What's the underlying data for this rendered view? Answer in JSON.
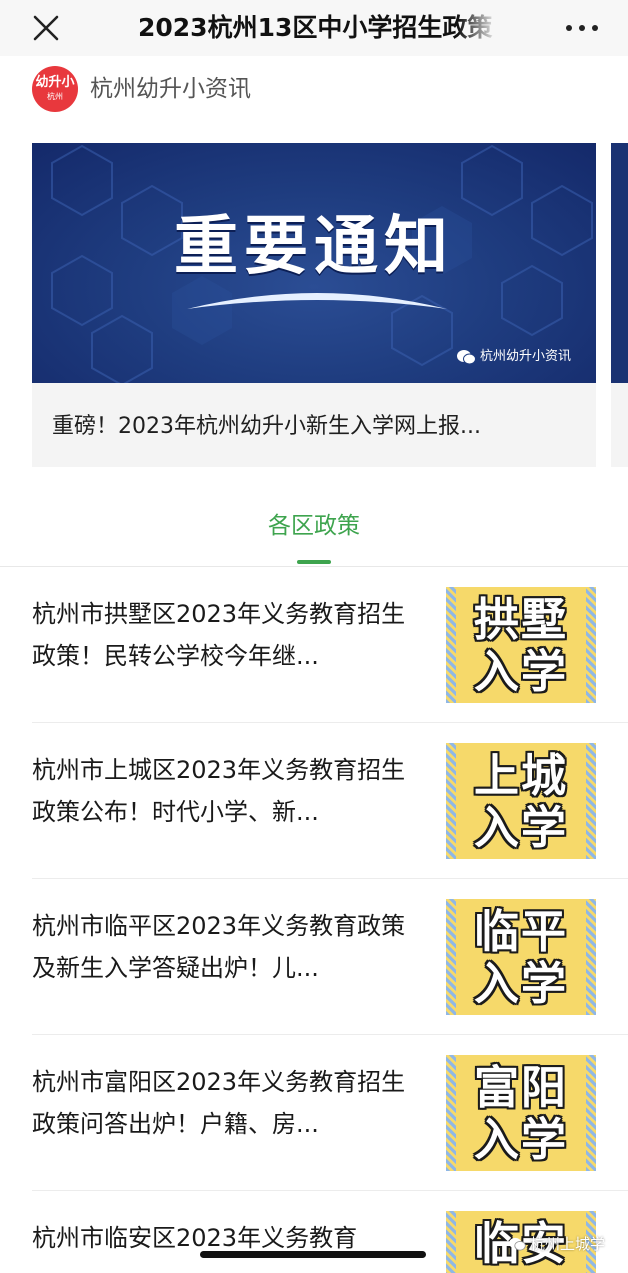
{
  "navbar": {
    "title": "2023杭州13区中小学招生政策",
    "close_icon": "close-icon",
    "more_icon": "more-dots-icon"
  },
  "account": {
    "avatar_line1": "幼升小",
    "avatar_line2": "杭州",
    "name": "杭州幼升小资讯"
  },
  "feature": {
    "banner_title": "重要通知",
    "banner_watermark": "杭州幼升小资讯",
    "caption": "重磅！2023年杭州幼升小新生入学网上报..."
  },
  "section": {
    "tab_label": "各区政策"
  },
  "articles": [
    {
      "title": "杭州市拱墅区2023年义务教育招生政策！民转公学校今年继...",
      "thumb_line1": "拱墅",
      "thumb_line2": "入学"
    },
    {
      "title": "杭州市上城区2023年义务教育招生政策公布！时代小学、新...",
      "thumb_line1": "上城",
      "thumb_line2": "入学"
    },
    {
      "title": "杭州市临平区2023年义务教育政策及新生入学答疑出炉！儿...",
      "thumb_line1": "临平",
      "thumb_line2": "入学"
    },
    {
      "title": "杭州市富阳区2023年义务教育招生政策问答出炉！户籍、房...",
      "thumb_line1": "富阳",
      "thumb_line2": "入学"
    },
    {
      "title": "杭州市临安区2023年义务教育",
      "thumb_line1": "临安",
      "thumb_line2": ""
    }
  ],
  "watermark": {
    "text": "杭州上城学"
  },
  "colors": {
    "accent_green": "#3ea44e",
    "banner_blue": "#1f3d80",
    "thumb_yellow": "#f6d96a",
    "avatar_red": "#e8383d"
  }
}
